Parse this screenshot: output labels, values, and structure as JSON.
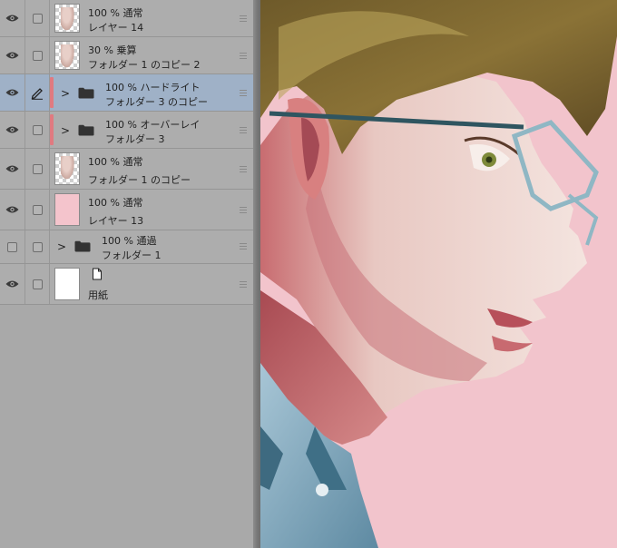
{
  "layers": [
    {
      "visible": true,
      "selected": false,
      "type": "layer",
      "thumb": "checker-figure",
      "opacity_mode": "100 % 通常",
      "name": "レイヤー 14"
    },
    {
      "visible": true,
      "selected": false,
      "type": "layer",
      "thumb": "checker-figure",
      "opacity_mode": "30 % 乗算",
      "name": "フォルダー 1 のコピー 2"
    },
    {
      "visible": true,
      "selected": true,
      "type": "folder",
      "color_label": "#e07a80",
      "editing": true,
      "opacity_mode": "100 % ハードライト",
      "name": "フォルダー 3 のコピー"
    },
    {
      "visible": true,
      "selected": false,
      "type": "folder",
      "color_label": "#e07a80",
      "opacity_mode": "100 % オーバーレイ",
      "name": "フォルダー 3"
    },
    {
      "visible": true,
      "selected": false,
      "type": "layer",
      "thumb": "checker-figure",
      "opacity_mode": "100 % 通常",
      "name": "フォルダー 1 のコピー"
    },
    {
      "visible": true,
      "selected": false,
      "type": "layer",
      "thumb": "pink",
      "opacity_mode": "100 % 通常",
      "name": "レイヤー 13"
    },
    {
      "visible": false,
      "selected": false,
      "type": "folder",
      "opacity_mode": "100 % 通過",
      "name": "フォルダー 1"
    },
    {
      "visible": true,
      "selected": false,
      "type": "paper",
      "thumb": "white",
      "name": "用紙"
    }
  ],
  "icons": {
    "visibility": "eye-icon",
    "edit": "pencil-icon",
    "folder": "folder-icon",
    "expand": "chevron-right-icon",
    "drag": "drag-handle-icon",
    "paper": "paper-icon"
  },
  "colors": {
    "panel_bg": "#adadad",
    "selected_row": "#9fb1c7",
    "canvas_bg": "#f2c4cc",
    "color_label": "#e07a80"
  }
}
